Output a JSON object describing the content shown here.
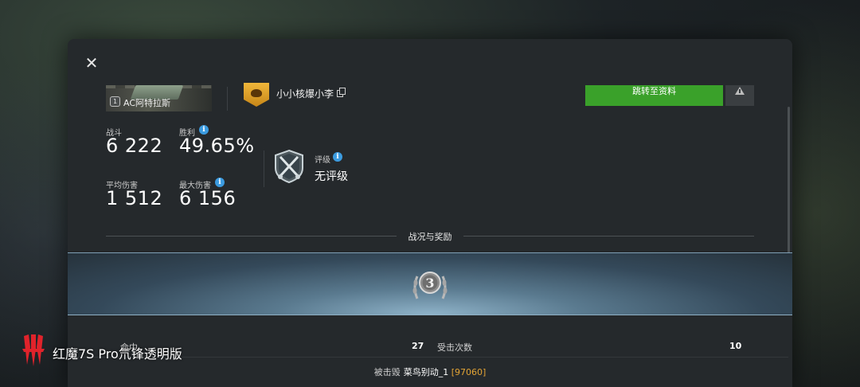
{
  "dialog": {
    "close_icon": "close-icon"
  },
  "header": {
    "vehicle": {
      "tier": "1",
      "name": "AC阿特拉斯"
    },
    "player_name": "小小核爆小李",
    "profile_button_label": "跳转至资料",
    "report_icon": "warning-icon"
  },
  "stats": {
    "battles_label": "战斗",
    "battles_value": "6 222",
    "win_label": "胜利",
    "win_value": "49.65%",
    "avg_damage_label": "平均伤害",
    "avg_damage_value": "1 512",
    "max_damage_label": "最大伤害",
    "max_damage_value": "6 156",
    "rating_label": "评级",
    "rating_value": "无评级",
    "info_icon": "i"
  },
  "section": {
    "title": "战况与奖励",
    "medal_number": "3"
  },
  "results": {
    "hits_label": "命中",
    "hits_value": "27",
    "received_label": "受击次数",
    "received_value": "10",
    "destroyed_by_label": "被击毁",
    "killer_name": "菜鸟别动_1",
    "killer_id": "[97060]"
  },
  "watermark": {
    "text": "红魔7S Pro氘锋透明版"
  }
}
